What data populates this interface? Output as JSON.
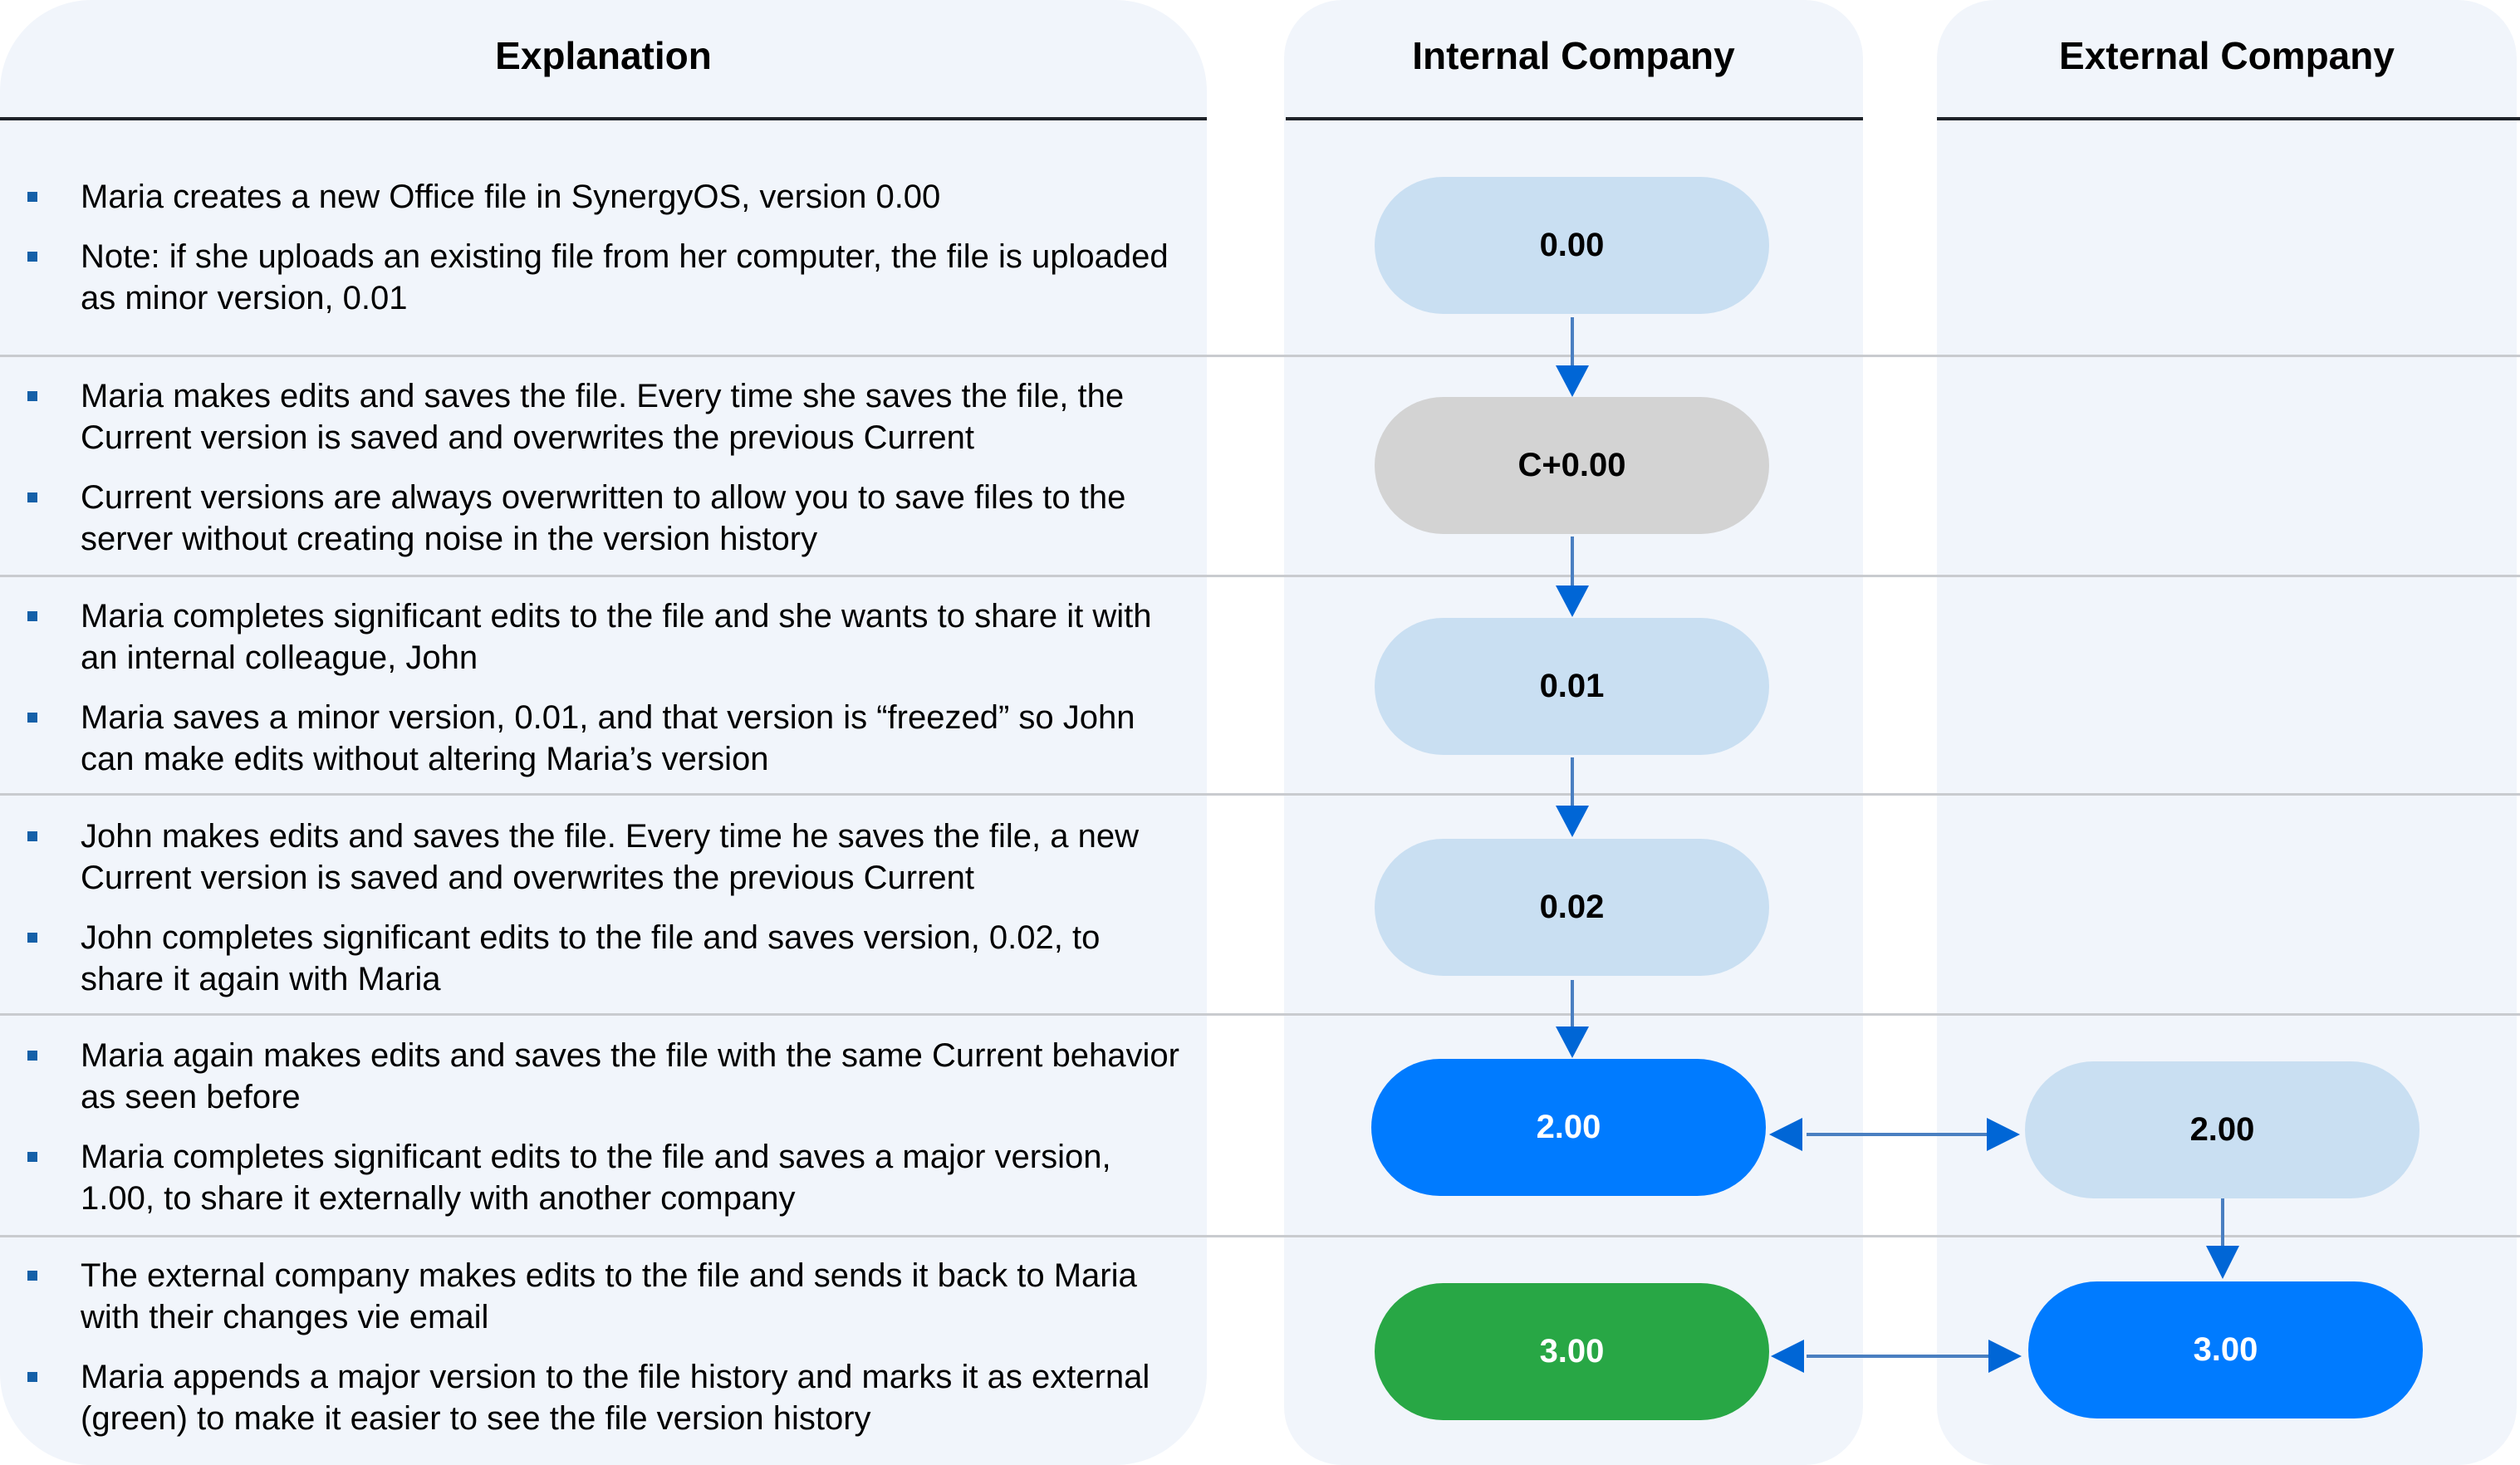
{
  "headers": {
    "explanation": "Explanation",
    "internal": "Internal Company",
    "external": "External Company"
  },
  "rows": [
    {
      "bullets": [
        "Maria creates a new Office file in SynergyOS, version 0.00",
        "Note: if she uploads an existing file from her computer, the file is uploaded as minor version, 0.01"
      ],
      "internal": {
        "label": "0.00",
        "style": "light-blue"
      },
      "external": null
    },
    {
      "bullets": [
        "Maria makes edits and saves the file. Every time she saves the file, the Current version is saved and overwrites the previous Current",
        "Current versions are always overwritten to allow you to save files to the server without creating noise in the version history"
      ],
      "internal": {
        "label": "C+0.00",
        "style": "gray"
      },
      "external": null
    },
    {
      "bullets": [
        "Maria completes significant edits to the file and she wants to share it with an internal colleague, John",
        "Maria saves a minor version, 0.01, and that version is “freezed” so John can make edits without altering Maria’s version"
      ],
      "internal": {
        "label": "0.01",
        "style": "light-blue"
      },
      "external": null
    },
    {
      "bullets": [
        "John makes edits and saves the file. Every time he saves the file, a new Current version is saved and overwrites the previous Current",
        "John completes significant edits to the file and saves version, 0.02, to share it again with Maria"
      ],
      "internal": {
        "label": "0.02",
        "style": "light-blue"
      },
      "external": null
    },
    {
      "bullets": [
        "Maria again makes edits and saves the file with the same Current behavior as seen before",
        "Maria completes significant edits to the file and saves a major version, 1.00, to share it externally with another company"
      ],
      "internal": {
        "label": "2.00",
        "style": "blue"
      },
      "external": {
        "label": "2.00",
        "style": "light-blue"
      }
    },
    {
      "bullets": [
        "The external company makes edits to the file and sends it back to Maria with their changes vie email",
        "Maria appends a major version to the file history and marks it as external (green) to make it easier to see the file version history"
      ],
      "internal": {
        "label": "3.00",
        "style": "green"
      },
      "external": {
        "label": "3.00",
        "style": "blue"
      }
    }
  ],
  "colors": {
    "panel_bg": "#f1f5fb",
    "light_blue": "#c9dff2",
    "gray": "#d3d3d3",
    "blue": "#007bff",
    "green": "#28a745",
    "arrow": "#0066d6",
    "bullet": "#1560a8"
  }
}
